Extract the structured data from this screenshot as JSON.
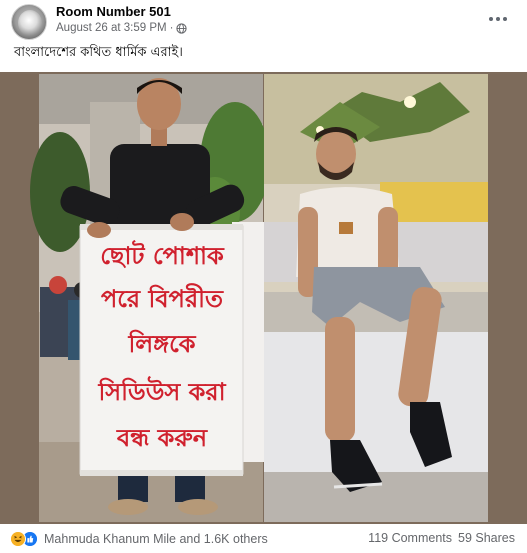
{
  "post": {
    "author": "Room Number 501",
    "date": "August 26 at 3:59 PM",
    "separator": "·",
    "caption": "বাংলাদেশের কথিত ধার্মিক এরাই।"
  },
  "sign": {
    "line1": "ছোট পোশাক",
    "line2": "পরে বিপরীত",
    "line3": "লিঙ্গকে",
    "line4": "সিডিউস করা",
    "line5": "বন্ধ করুন"
  },
  "footer": {
    "reactors": "Mahmuda Khanum Mile and 1.6K others",
    "comments": "119 Comments",
    "shares": "59 Shares"
  },
  "icons": {
    "privacy": "globe-icon",
    "menu": "more-horizontal-icon",
    "reaction_1": "haha-icon",
    "reaction_2": "like-icon"
  },
  "colors": {
    "name": "#050505",
    "meta": "#65676b",
    "like": "#1877f2",
    "haha": "#f7b125",
    "sign_text": "#d0212e"
  }
}
